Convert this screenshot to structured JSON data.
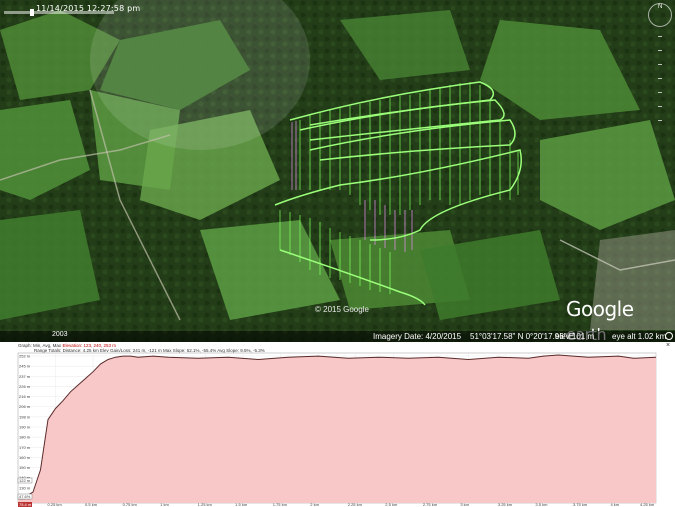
{
  "app": {
    "timestamp": "11/14/2015 12:27:58 pm",
    "year_badge": "2003",
    "copyright": "© 2015 Google",
    "logo_brand": "Google",
    "logo_product": " earth"
  },
  "status_bar": {
    "imagery_date": "Imagery Date: 4/20/2015",
    "coords": "51°03'17.58\" N   0°20'17.96\" E",
    "elev": "elev   101 m",
    "eye_alt": "eye alt   1.02 km"
  },
  "navigation": {
    "north_label": "N"
  },
  "profile_panel": {
    "stats_label": "Graph: Min, Avg, Max",
    "stats_range": "Elevation: 123, 240, 253 m",
    "range_totals": "Range Totals:  Distance: 4.25 km   Elev Gain/Loss: 241 m, -121 m   Max Slope: 52.1%, -55.4%   Avg Slope: 9.5%, -5.3%",
    "close_icon": "×",
    "y_axis_labels": [
      "252 m",
      "245 m",
      "237 m",
      "226 m",
      "216 m",
      "206 m",
      "198 m",
      "190 m",
      "180 m",
      "170 m",
      "160 m",
      "150 m",
      "140 m",
      "130 m",
      "122 m"
    ],
    "x_axis_labels": [
      "0.25 km",
      "0.5 km",
      "0.75 km",
      "1 km",
      "1.25 km",
      "1.5 km",
      "1.75 km",
      "2 km",
      "2.25 km",
      "2.5 km",
      "2.75 km",
      "3 km",
      "3.25 km",
      "3.5 km",
      "3.75 km",
      "4 km",
      "4.25 km"
    ],
    "x_start_label": "75.4 m",
    "y_current_label": "122 m",
    "y_percent_label": "47.6%",
    "x_end_label": "4.25 km",
    "fill_color": "#f8c8c8",
    "line_color": "#5a2a2a"
  },
  "chart_data": {
    "type": "area",
    "title": "",
    "xlabel": "",
    "ylabel": "",
    "xlim": [
      0,
      4.25
    ],
    "ylim": [
      122,
      253
    ],
    "x": [
      0,
      0.05,
      0.1,
      0.15,
      0.2,
      0.25,
      0.3,
      0.35,
      0.4,
      0.45,
      0.5,
      0.55,
      0.6,
      0.65,
      0.7,
      0.75,
      0.8,
      0.9,
      1.0,
      1.2,
      1.4,
      1.6,
      1.8,
      2.0,
      2.2,
      2.4,
      2.6,
      2.8,
      3.0,
      3.2,
      3.4,
      3.5,
      3.6,
      3.8,
      4.0,
      4.1,
      4.25
    ],
    "y": [
      124,
      126,
      130,
      150,
      195,
      205,
      212,
      220,
      226,
      232,
      238,
      245,
      249,
      251,
      252,
      252,
      251,
      252,
      251,
      250,
      251,
      249,
      251,
      252,
      250,
      251,
      250,
      251,
      249,
      251,
      250,
      252,
      253,
      251,
      252,
      250,
      251
    ],
    "series": [
      {
        "name": "",
        "values": []
      }
    ]
  }
}
